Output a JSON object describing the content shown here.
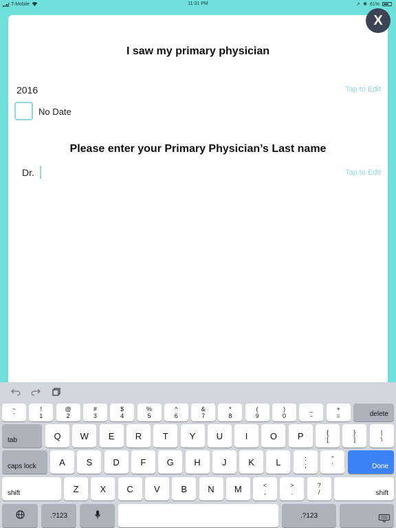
{
  "status_bar": {
    "carrier": "T-Mobile",
    "time": "11:31 PM",
    "battery": "61%"
  },
  "close_label": "X",
  "form": {
    "title": "I saw my primary physician",
    "year": "2016",
    "tap_to_edit_1": "Tap to Edit",
    "no_date_label": "No Date",
    "question": "Please enter your Primary Physician’s Last name",
    "prefix": "Dr.",
    "tap_to_edit_2": "Tap to Edit"
  },
  "keyboard": {
    "toolbar_icons": [
      "undo-icon",
      "redo-icon",
      "clipboard-icon"
    ],
    "number_row": [
      {
        "top": "~",
        "bottom": "`"
      },
      {
        "top": "!",
        "bottom": "1"
      },
      {
        "top": "@",
        "bottom": "2"
      },
      {
        "top": "#",
        "bottom": "3"
      },
      {
        "top": "$",
        "bottom": "4"
      },
      {
        "top": "%",
        "bottom": "5"
      },
      {
        "top": "^",
        "bottom": "6"
      },
      {
        "top": "&",
        "bottom": "7"
      },
      {
        "top": "*",
        "bottom": "8"
      },
      {
        "top": "(",
        "bottom": "9"
      },
      {
        "top": ")",
        "bottom": "0"
      },
      {
        "top": "_",
        "bottom": "-"
      },
      {
        "top": "+",
        "bottom": "="
      }
    ],
    "delete": "delete",
    "tab": "tab",
    "row_q": [
      "Q",
      "W",
      "E",
      "R",
      "T",
      "Y",
      "U",
      "I",
      "O",
      "P"
    ],
    "row_q_symbols": [
      {
        "top": "{",
        "bottom": "["
      },
      {
        "top": "}",
        "bottom": "]"
      },
      {
        "top": "|",
        "bottom": "\\"
      }
    ],
    "caps_lock": "caps lock",
    "row_a": [
      "A",
      "S",
      "D",
      "F",
      "G",
      "H",
      "J",
      "K",
      "L"
    ],
    "row_a_symbols": [
      {
        "top": ":",
        "bottom": ";"
      },
      {
        "top": "\"",
        "bottom": "'"
      }
    ],
    "done": "Done",
    "shift": "shift",
    "row_z": [
      "Z",
      "X",
      "C",
      "V",
      "B",
      "N",
      "M"
    ],
    "row_z_symbols": [
      {
        "top": "<",
        "bottom": ","
      },
      {
        "top": ">",
        "bottom": "."
      },
      {
        "top": "?",
        "bottom": "/"
      }
    ],
    "numbers_key": ".?123"
  }
}
